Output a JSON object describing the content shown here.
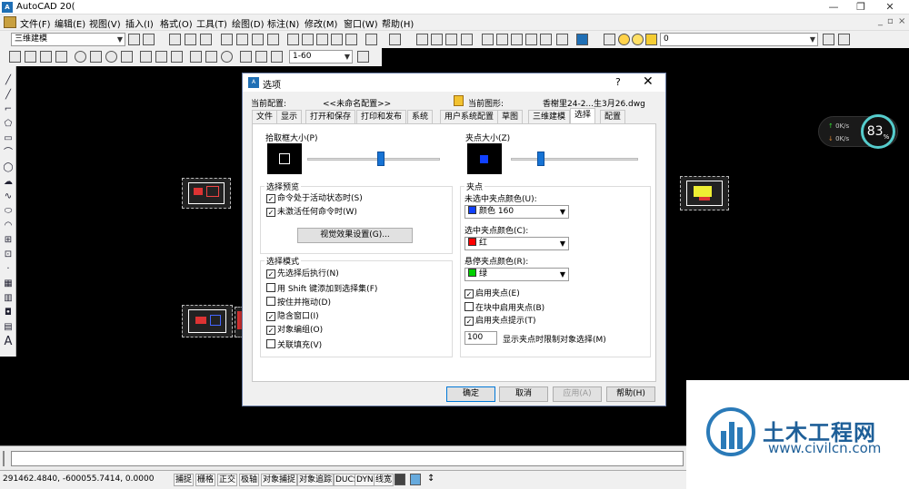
{
  "app": {
    "title": "AutoCAD 20("
  },
  "menu": [
    "文件(F)",
    "编辑(E)",
    "视图(V)",
    "插入(I)",
    "格式(O)",
    "工具(T)",
    "绘图(D)",
    "标注(N)",
    "修改(M)",
    "窗口(W)",
    "帮助(H)"
  ],
  "toolbar": {
    "workspace": "三维建模",
    "layer_combo": "0",
    "scale_combo": "1-60"
  },
  "status": {
    "coords": "291462.4840, -600055.7414, 0.0000",
    "buttons": [
      "捕捉",
      "栅格",
      "正交",
      "极轴",
      "对象捕捉",
      "对象追踪",
      "DUCS",
      "DYN",
      "线宽"
    ]
  },
  "gauge": {
    "percent": "83",
    "percent_unit": "%",
    "up": "0K/s",
    "down": "0K/s"
  },
  "watermark": {
    "title": "土木工程网",
    "url": "www.civilcn.com"
  },
  "dialog": {
    "title": "选项",
    "help": "?",
    "close": "✕",
    "current_profile_label": "当前配置:",
    "current_profile": "<<未命名配置>>",
    "current_drawing_label": "当前图形:",
    "current_drawing": "香榭里24-2...生3月26.dwg",
    "tabs": [
      "文件",
      "显示",
      "打开和保存",
      "打印和发布",
      "系统",
      "用户系统配置",
      "草图",
      "三维建模",
      "选择",
      "配置"
    ],
    "pickbox": {
      "title": "拾取框大小(P)",
      "level": 0.56
    },
    "grip_size": {
      "title": "夹点大小(Z)",
      "level": 0.22
    },
    "selection_preview": {
      "title": "选择预览",
      "opt1": "命令处于活动状态时(S)",
      "opt2": "未激活任何命令时(W)",
      "button": "视觉效果设置(G)..."
    },
    "selection_mode": {
      "title": "选择模式",
      "items": [
        {
          "label": "先选择后执行(N)",
          "checked": true
        },
        {
          "label": "用 Shift 键添加到选择集(F)",
          "checked": false
        },
        {
          "label": "按住并拖动(D)",
          "checked": false
        },
        {
          "label": "隐含窗口(I)",
          "checked": true
        },
        {
          "label": "对象编组(O)",
          "checked": true
        },
        {
          "label": "关联填充(V)",
          "checked": false
        }
      ]
    },
    "grips": {
      "title": "夹点",
      "unselected_label": "未选中夹点颜色(U):",
      "unselected": {
        "text": "颜色 160",
        "color": "#1040ff"
      },
      "selected_label": "选中夹点颜色(C):",
      "selected": {
        "text": "红",
        "color": "#ff0000"
      },
      "hover_label": "悬停夹点颜色(R):",
      "hover": {
        "text": "绿",
        "color": "#00d000"
      },
      "enable_grips": "启用夹点(E)",
      "enable_grips_blocks": "在块中启用夹点(B)",
      "enable_tips": "启用夹点提示(T)",
      "limit_value": "100",
      "limit_label": "显示夹点时限制对象选择(M)"
    },
    "buttons": {
      "ok": "确定",
      "cancel": "取消",
      "apply": "应用(A)",
      "help": "帮助(H)"
    }
  }
}
